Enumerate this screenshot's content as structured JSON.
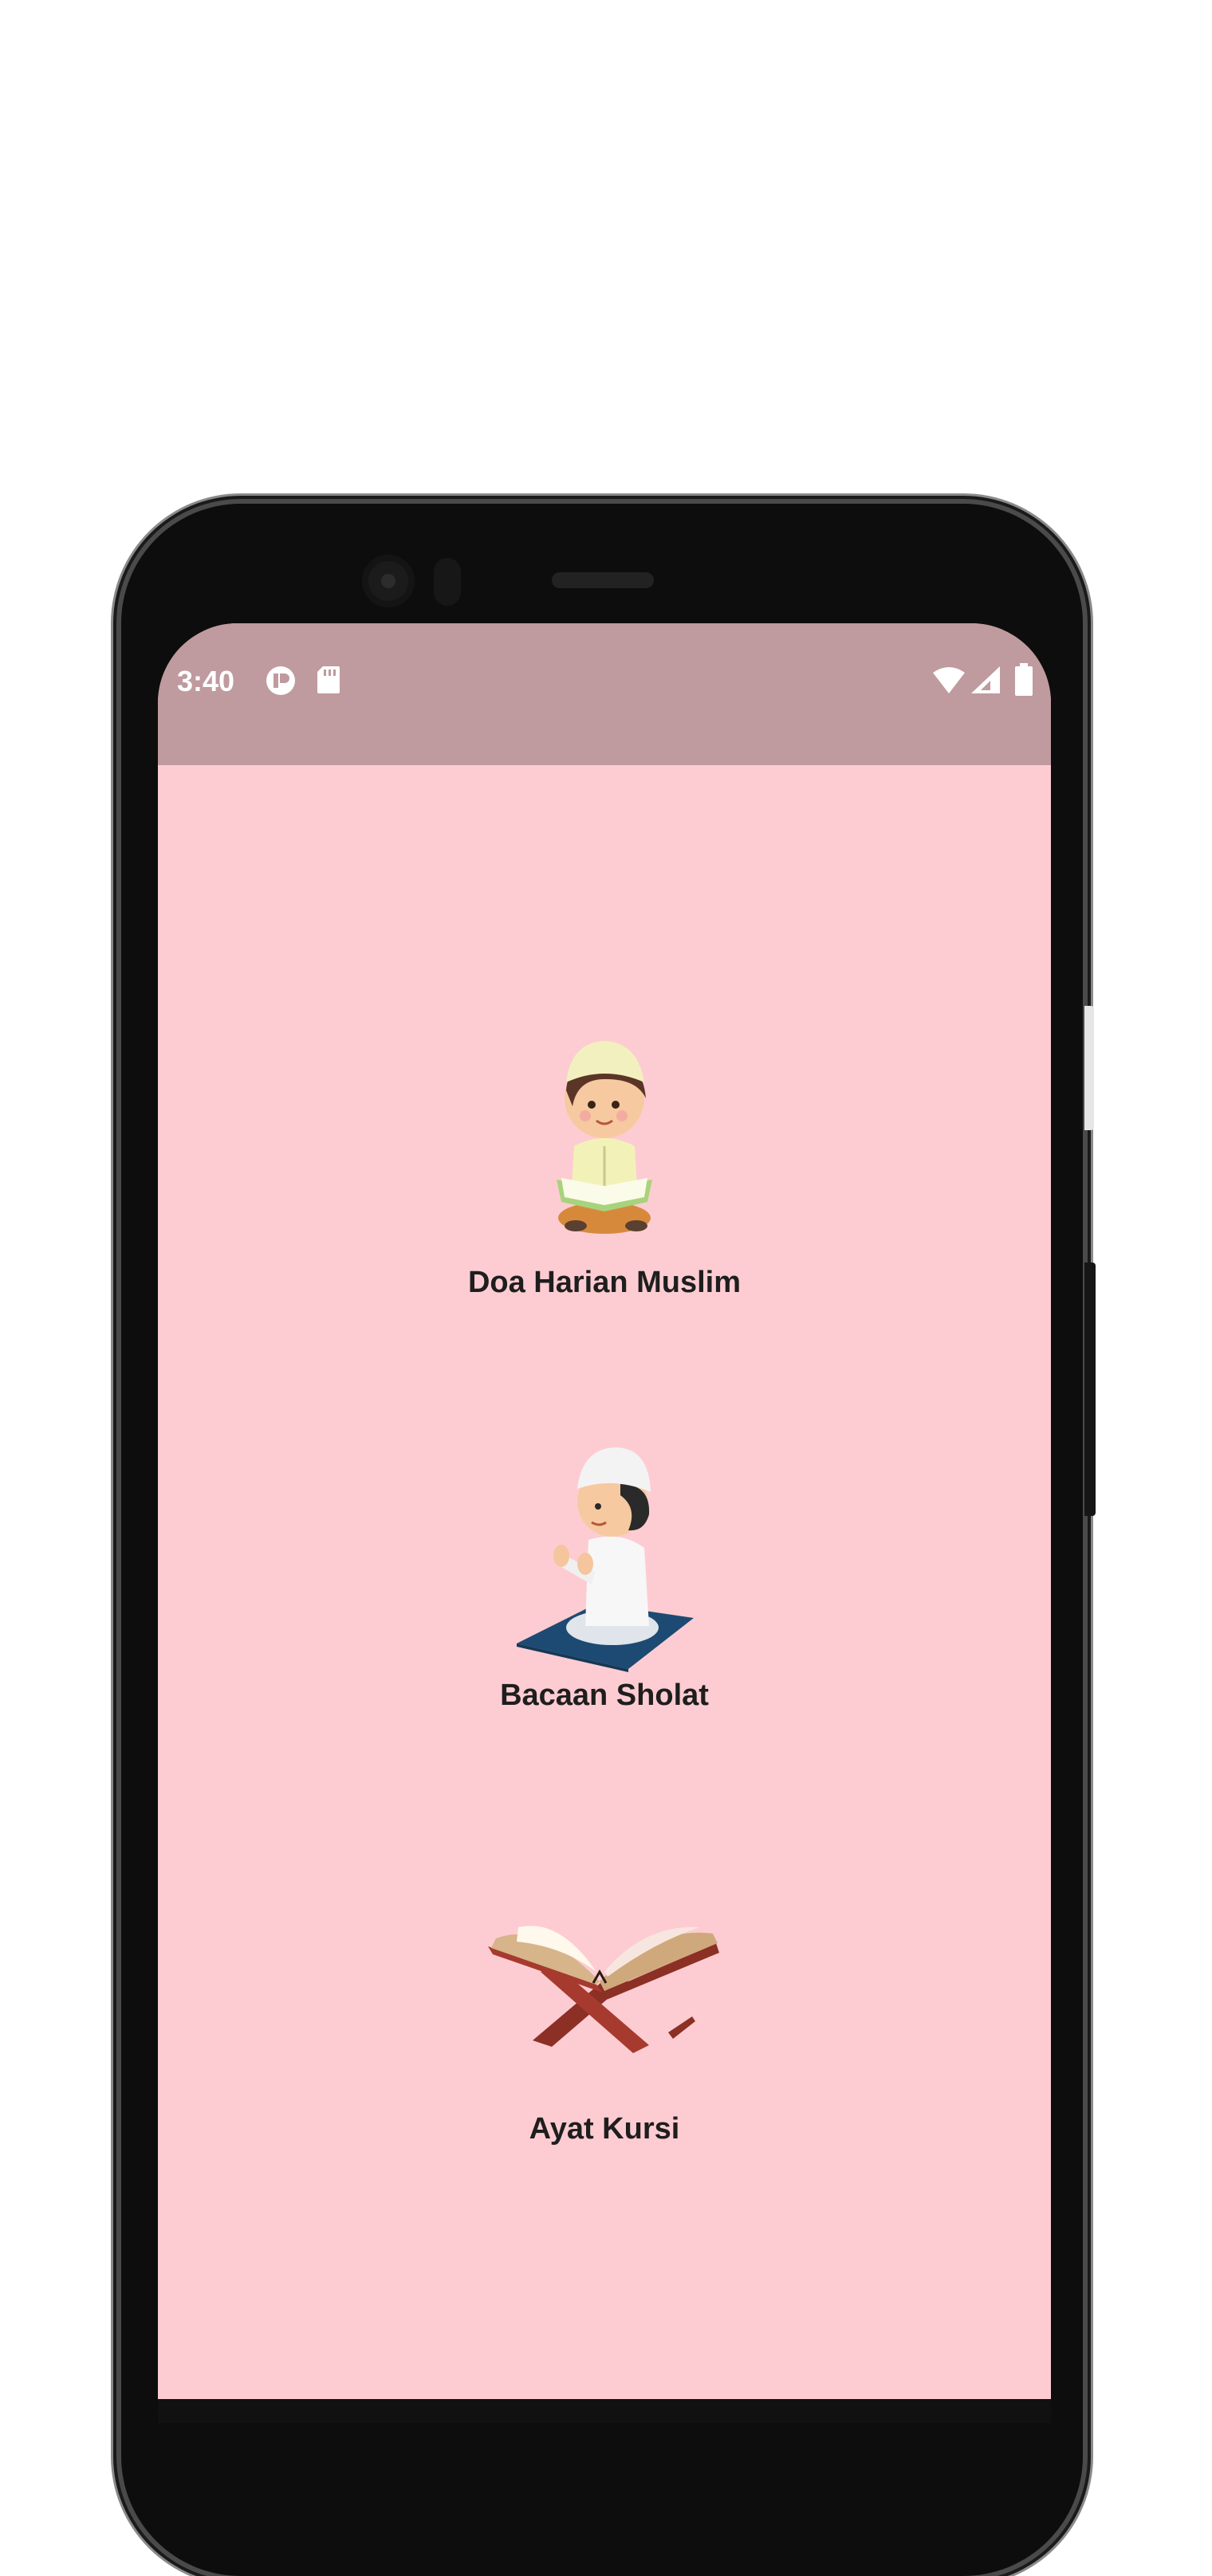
{
  "status_bar": {
    "time": "3:40",
    "left_icons": [
      "app-notification-icon",
      "sd-card-icon"
    ],
    "right_icons": [
      "wifi-icon",
      "cell-signal-icon",
      "battery-icon"
    ],
    "color": "#bf9a9e"
  },
  "theme": {
    "background": "#fdccd2",
    "text": "#1e1e1e"
  },
  "menu": {
    "items": [
      {
        "label": "Doa Harian Muslim",
        "icon": "boy-reading-quran-icon"
      },
      {
        "label": "Bacaan Sholat",
        "icon": "boy-praying-icon"
      },
      {
        "label": "Ayat Kursi",
        "icon": "quran-on-stand-icon"
      }
    ]
  }
}
